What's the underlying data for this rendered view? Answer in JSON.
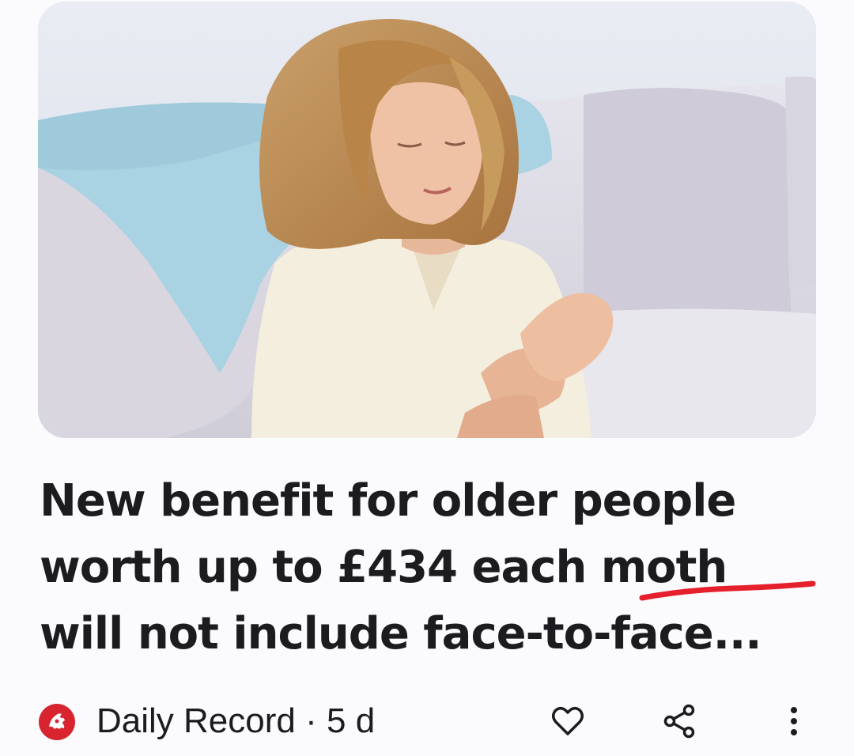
{
  "article": {
    "image_alt": "Woman holding her wrist on a sofa",
    "headline_lines": [
      "New benefit for older people",
      "worth up to £434 each moth",
      "will not include face-to-face..."
    ],
    "highlighted_word": "moth",
    "annotation_color": "#e5202c"
  },
  "footer": {
    "source_name": "Daily Record",
    "separator": "·",
    "age": "5 d",
    "source_logo_color": "#d8242f",
    "icons": {
      "like": "heart-icon",
      "share": "share-icon",
      "more": "more-vert-icon"
    }
  }
}
